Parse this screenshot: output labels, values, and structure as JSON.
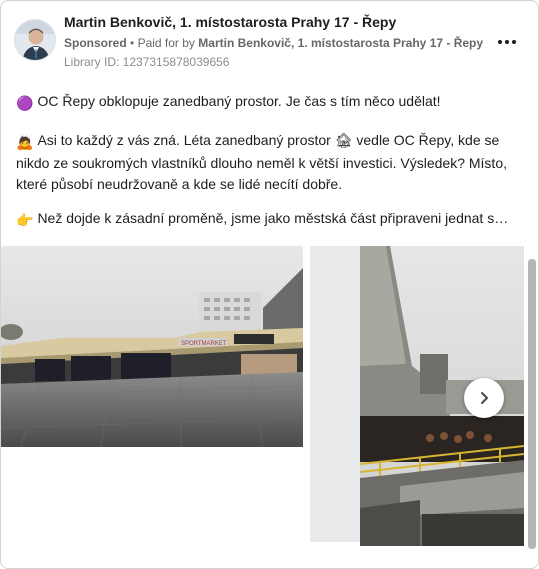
{
  "post": {
    "author": "Martin Benkovič, 1. místostarosta Prahy 17 - Řepy",
    "sponsored_label": "Sponsored",
    "paid_for_prefix": "Paid for by",
    "advertiser": "Martin Benkovič, 1. místostarosta Prahy 17 - Řepy",
    "separator": "•",
    "library_id": "Library ID: 1237315878039656",
    "paragraphs": [
      {
        "emoji": "🟣",
        "text": "OC Řepy obklopuje zanedbaný prostor. Je čas s tím něco udělat!"
      },
      {
        "emoji": "🙇",
        "text": "Asi to každý z vás zná. Léta zanedbaný prostor 🏚 vedle OC Řepy, kde se nikdo ze soukromých vlastníků dlouho neměl k větší investici. Výsledek? Místo, které působí neudržovaně a kde se lidé necítí dobře."
      },
      {
        "emoji": "👉",
        "text": "Než dojde k zásadní proměně, jsme jako městská část připraveni jednat s…"
      }
    ]
  },
  "photos": {
    "photo1_sign": "SPORTMARKET"
  },
  "icons": {
    "more": "more-horizontal-icon",
    "next": "chevron-right-icon"
  }
}
